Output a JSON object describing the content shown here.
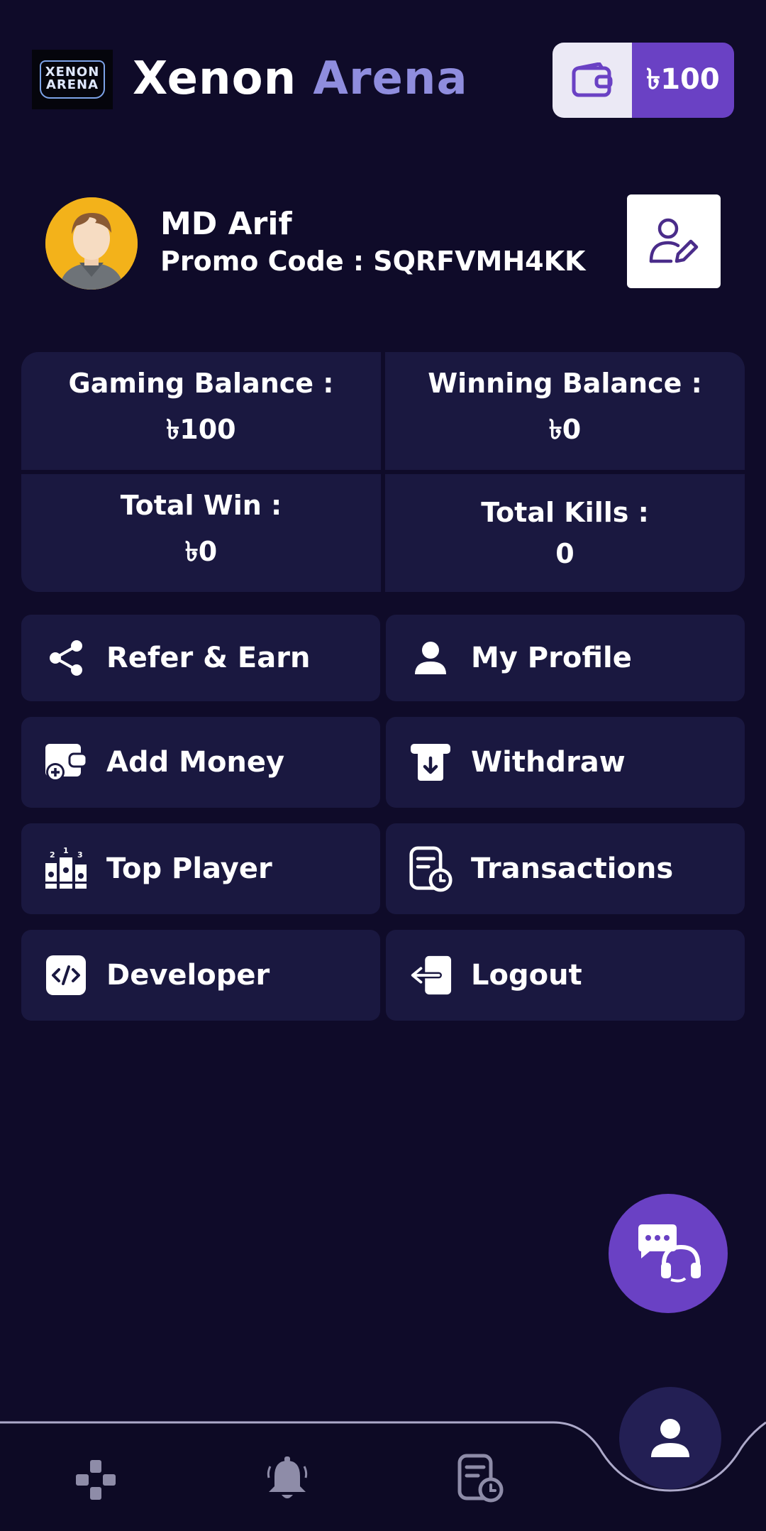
{
  "header": {
    "logo_line1": "XENON",
    "logo_line2": "ARENA",
    "title_part1": "Xenon",
    "title_part2": "Arena",
    "wallet_amount": "৳100"
  },
  "profile": {
    "name": "MD Arif",
    "promo": "Promo Code : SQRFVMH4KK"
  },
  "stats": [
    {
      "label": "Gaming Balance :",
      "value": "৳100"
    },
    {
      "label": "Winning Balance :",
      "value": "৳0"
    },
    {
      "label": "Total Win :",
      "value": "৳0"
    },
    {
      "label": "Total Kills :",
      "value": "0"
    }
  ],
  "menu": [
    {
      "label": "Refer & Earn",
      "icon": "share-icon"
    },
    {
      "label": "My Profile",
      "icon": "user-icon"
    },
    {
      "label": "Add Money",
      "icon": "wallet-add-icon"
    },
    {
      "label": "Withdraw",
      "icon": "withdraw-icon"
    },
    {
      "label": "Top Player",
      "icon": "podium-icon"
    },
    {
      "label": "Transactions",
      "icon": "transactions-icon"
    },
    {
      "label": "Developer",
      "icon": "code-icon"
    },
    {
      "label": "Logout",
      "icon": "logout-icon"
    }
  ],
  "bottom_nav": [
    "gamepad-icon",
    "bell-icon",
    "history-icon",
    "profile-icon"
  ],
  "colors": {
    "background": "#0f0b29",
    "card": "#1a1840",
    "accent": "#6a41c4",
    "title_accent": "#8f8dde"
  }
}
